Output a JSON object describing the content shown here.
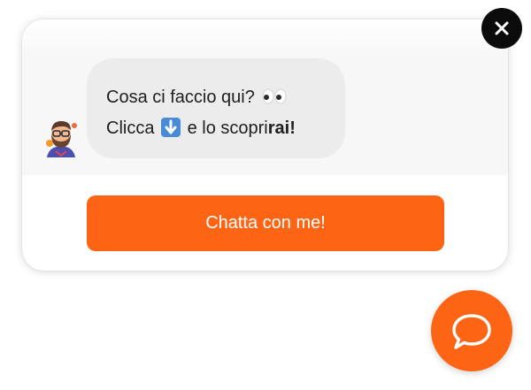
{
  "widget": {
    "message": {
      "line1_text": "Cosa ci faccio qui?",
      "line1_emoji": "eyes-emoji",
      "line2_prefix": "Clicca",
      "line2_emoji": "down-arrow-emoji",
      "line2_plain": "e lo scopri",
      "line2_bold": "rai!"
    },
    "cta_label": "Chatta con me!",
    "avatar_icon": "bearded-man-avatar",
    "close_icon": "close-icon",
    "launcher_icon": "chat-bubble-icon"
  },
  "colors": {
    "accent": "#fd6414",
    "bubble_bg": "#ececec",
    "close_bg": "#0c0c0c",
    "text": "#1e1e1e"
  }
}
